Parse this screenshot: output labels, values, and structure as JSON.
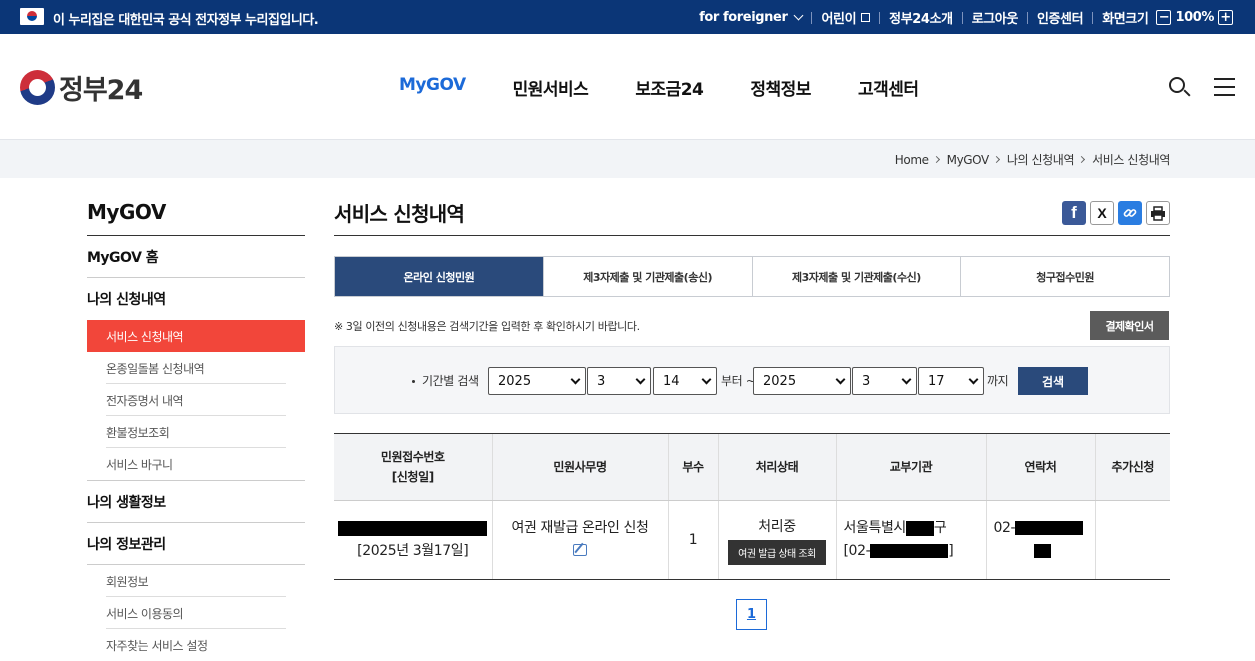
{
  "gov_banner": {
    "official_text": "이 누리집은 대한민국 공식 전자정부 누리집입니다.",
    "links": [
      "for foreigner",
      "어린이",
      "정부24소개",
      "로그아웃",
      "인증센터"
    ],
    "zoom_label": "화면크기",
    "zoom_minus": "−",
    "zoom_value": "100%",
    "zoom_plus": "+"
  },
  "header": {
    "logo_text": "정부24",
    "nav": [
      "MyGOV",
      "민원서비스",
      "보조금24",
      "정책정보",
      "고객센터"
    ],
    "active_nav": "MyGOV"
  },
  "breadcrumb": [
    "Home",
    "MyGOV",
    "나의 신청내역",
    "서비스 신청내역"
  ],
  "sidebar": {
    "title": "MyGOV",
    "home": "MyGOV 홈",
    "section1": "나의 신청내역",
    "section1_items": [
      "서비스 신청내역",
      "온종일돌봄 신청내역",
      "전자증명서 내역",
      "환불정보조회",
      "서비스 바구니"
    ],
    "section2": "나의 생활정보",
    "section3": "나의 정보관리",
    "section3_items": [
      "회원정보",
      "서비스 이용동의",
      "자주찾는 서비스 설정"
    ]
  },
  "main": {
    "title": "서비스 신청내역",
    "share_icons": [
      "facebook-icon",
      "x-icon",
      "link-icon",
      "print-icon"
    ],
    "tabs": [
      "온라인 신청민원",
      "제3자제출 및 기관제출(송신)",
      "제3자제출 및 기관제출(수신)",
      "청구접수민원"
    ],
    "active_tab": "온라인 신청민원",
    "notice": "※ 3일 이전의 신청내용은 검색기간을 입력한 후 확인하시기 바랍니다.",
    "receipt_button": "결제확인서",
    "search": {
      "label": "기간별 검색",
      "from_year": "2025",
      "from_month": "3",
      "from_day": "14",
      "from_suffix": "부터 ~",
      "to_year": "2025",
      "to_month": "3",
      "to_day": "17",
      "to_suffix": "까지",
      "button": "검색"
    },
    "table": {
      "headers": {
        "receipt_no": "민원접수번호",
        "receipt_date": "[신청일]",
        "name": "민원사무명",
        "copies": "부수",
        "status": "처리상태",
        "agency": "교부기관",
        "contact": "연락처",
        "extra": "추가신청"
      },
      "rows": [
        {
          "date": "[2025년 3월17일]",
          "name": "여권 재발급 온라인 신청",
          "copies": "1",
          "status": "처리중",
          "status_button": "여권 발급 상태 조회",
          "agency_prefix": "서울특별시",
          "agency_suffix": "구",
          "agency_phone_prefix": "[02-",
          "agency_phone_suffix": "]",
          "contact_prefix": "02-"
        }
      ]
    },
    "page": "1"
  },
  "colors": {
    "gov_bar": "#0b3677",
    "accent": "#1c6ad8",
    "active_tab": "#2a4a7b",
    "sidebar_active": "#f2463a"
  }
}
